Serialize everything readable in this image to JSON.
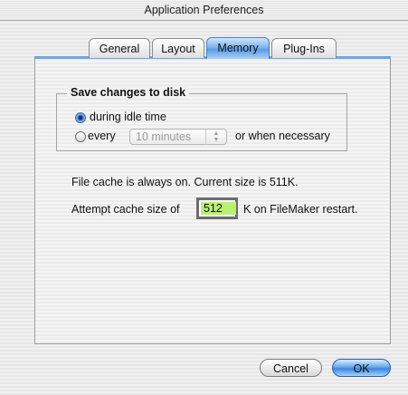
{
  "window": {
    "title": "Application Preferences"
  },
  "tabs": [
    {
      "label": "General",
      "active": false
    },
    {
      "label": "Layout",
      "active": false
    },
    {
      "label": "Memory",
      "active": true
    },
    {
      "label": "Plug-Ins",
      "active": false
    }
  ],
  "save_group": {
    "title": "Save changes to disk",
    "option_idle": {
      "label": "during idle time",
      "selected": true
    },
    "option_every": {
      "label": "every",
      "selected": false,
      "interval_value": "10 minutes",
      "suffix": "or when necessary"
    }
  },
  "cache": {
    "info_text": "File cache is always on.  Current size is 511K.",
    "attempt_prefix": "Attempt cache size of",
    "value": "512",
    "attempt_suffix": "K on FileMaker restart."
  },
  "buttons": {
    "cancel": "Cancel",
    "ok": "OK"
  },
  "colors": {
    "tab_active": "#5a9de6",
    "cache_field_bg": "#b9f06f",
    "default_button": "#3b86e0"
  }
}
